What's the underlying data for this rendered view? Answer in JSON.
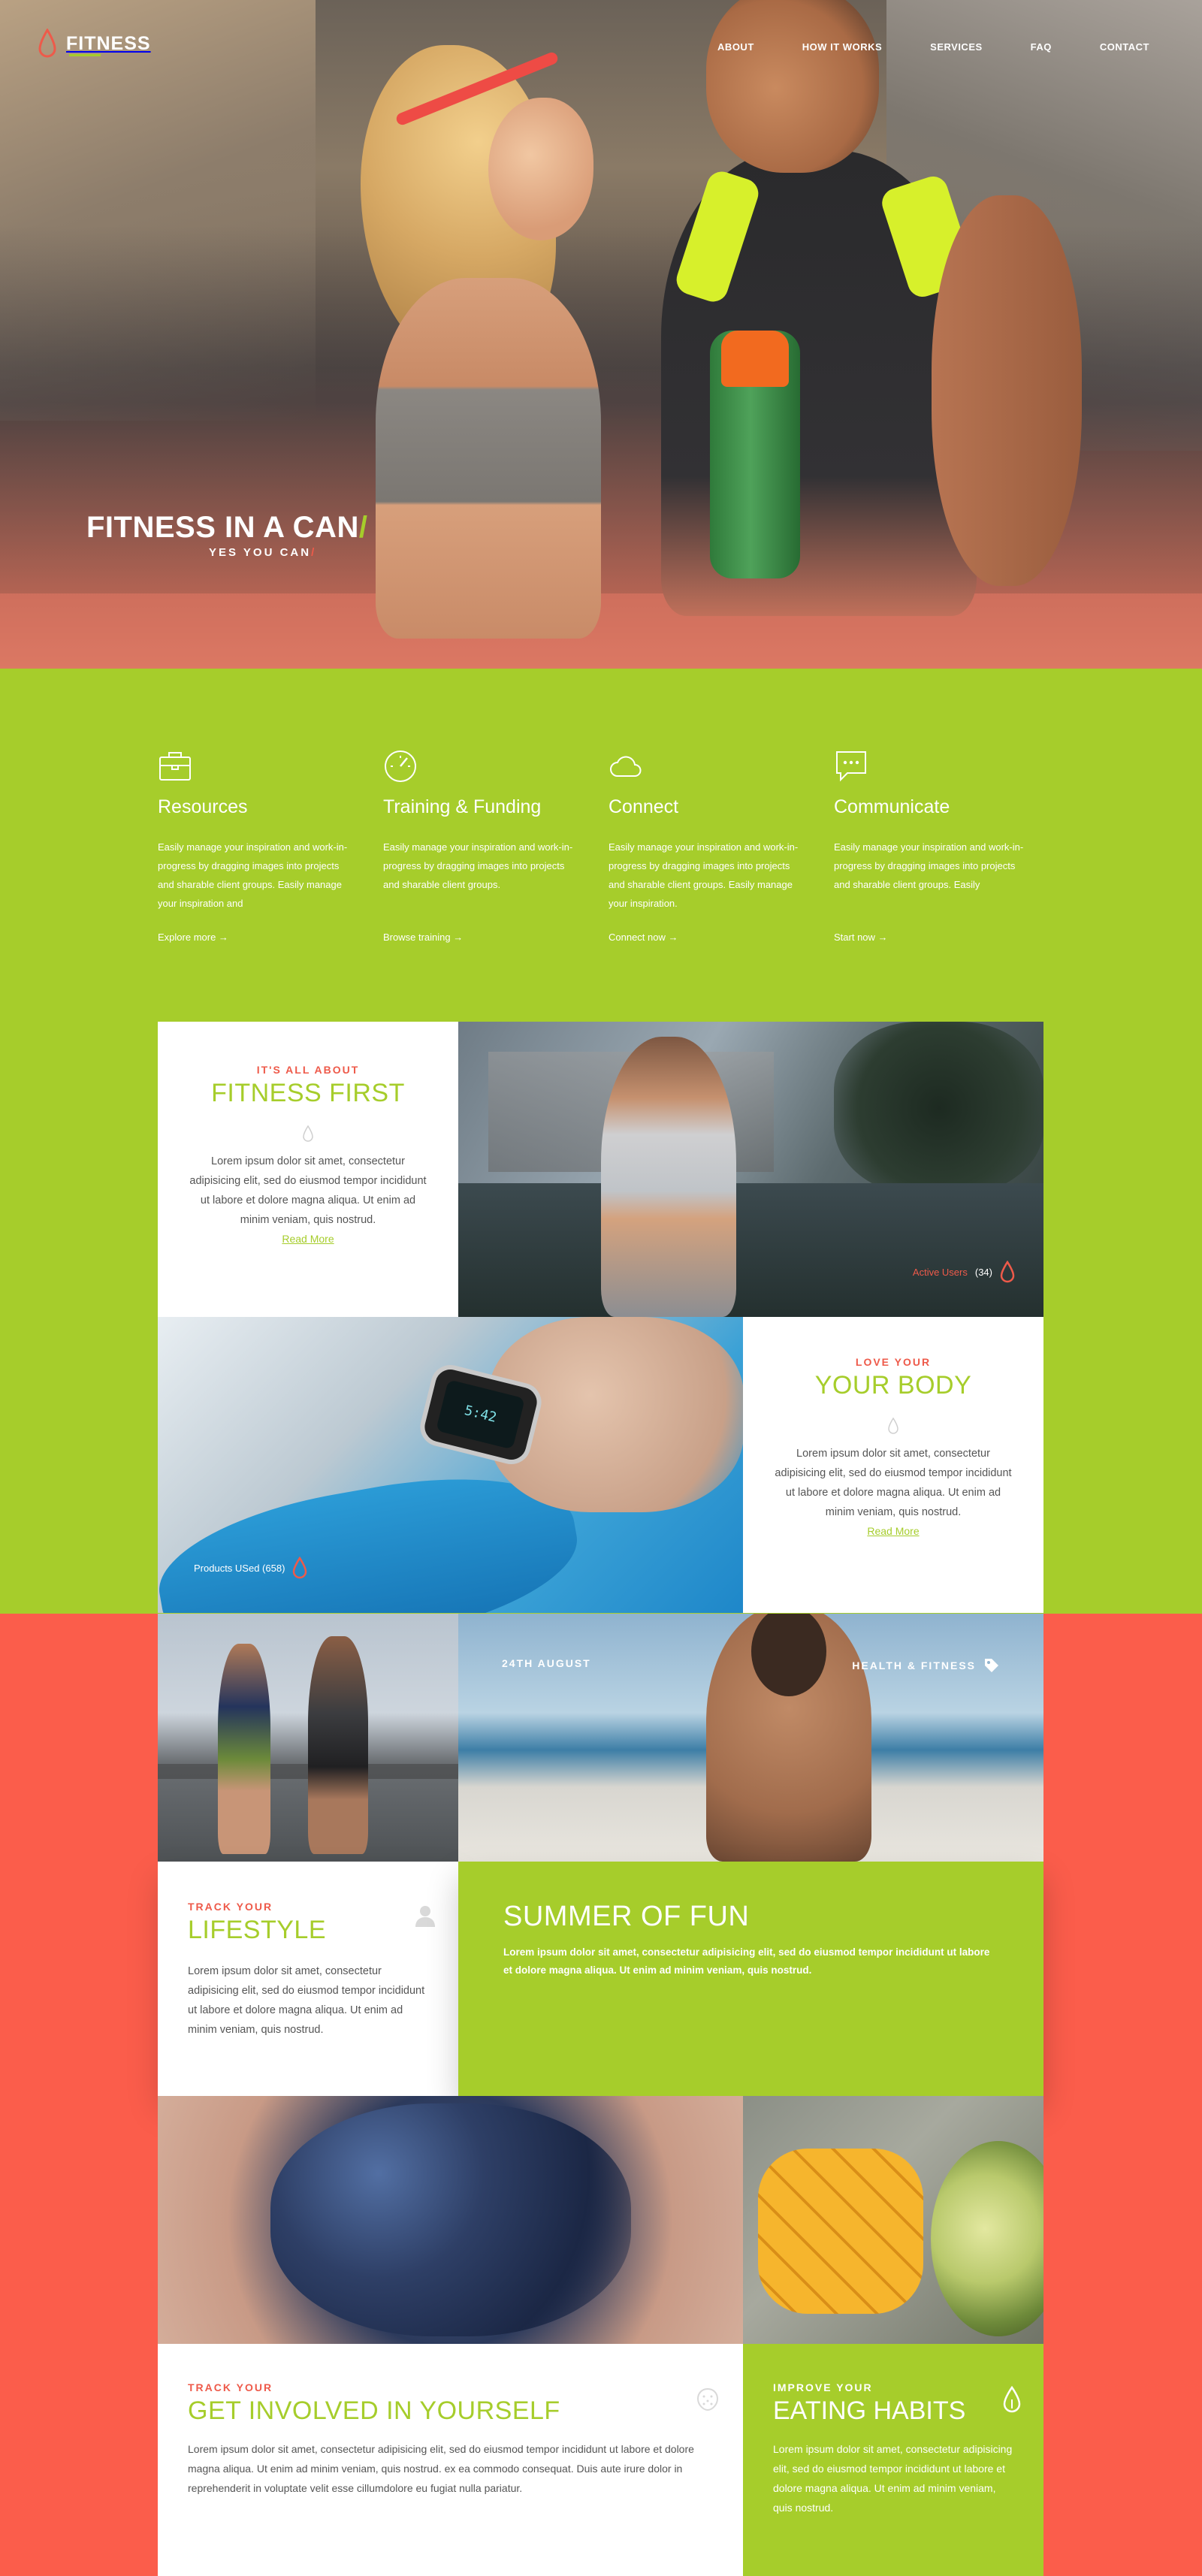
{
  "brand": {
    "name": "FITNESS",
    "accent": "#a6cd2b",
    "red": "#fb5d4b"
  },
  "nav": {
    "items": [
      "ABOUT",
      "HOW IT WORKS",
      "SERVICES",
      "FAQ",
      "CONTACT"
    ]
  },
  "hero": {
    "title": "FITNESS IN A CAN",
    "title_slash": "/",
    "subtitle": "YES YOU CAN",
    "subtitle_slash": "/"
  },
  "features": [
    {
      "icon": "briefcase-icon",
      "title": "Resources",
      "text": "Easily manage your inspiration and work-in-progress by dragging images into projects and sharable client groups. Easily manage your inspiration and",
      "link": "Explore more →"
    },
    {
      "icon": "speedometer-icon",
      "title": "Training & Funding",
      "text": "Easily manage your inspiration and work-in-progress by dragging images into projects and sharable client groups.",
      "link": "Browse training →"
    },
    {
      "icon": "cloud-icon",
      "title": "Connect",
      "text": "Easily manage your inspiration and work-in-progress by dragging images into projects and sharable client groups. Easily manage your inspiration.",
      "link": "Connect now →"
    },
    {
      "icon": "chat-bubble-icon",
      "title": "Communicate",
      "text": "Easily manage your inspiration and work-in-progress by dragging images into projects and sharable client groups. Easily",
      "link": "Start now →"
    }
  ],
  "fitness_first": {
    "kicker": "IT'S ALL ABOUT",
    "title": "FITNESS FIRST",
    "text": "Lorem ipsum dolor sit amet, consectetur adipisicing elit, sed do eiusmod tempor incididunt ut labore et dolore magna aliqua. Ut enim ad minim veniam, quis nostrud.",
    "link": "Read More",
    "tag_label": "Active Users",
    "tag_count": "(34)"
  },
  "love_body": {
    "kicker": "LOVE YOUR",
    "title": "YOUR BODY",
    "text": "Lorem ipsum dolor sit amet, consectetur adipisicing elit, sed do eiusmod tempor incididunt ut labore et dolore magna aliqua. Ut enim ad minim veniam, quis nostrud.",
    "link": "Read More",
    "tag_label": "Products USed (658)",
    "watch_time": "5:42"
  },
  "blog": {
    "date": "24TH AUGUST",
    "category": "HEALTH & FITNESS"
  },
  "lifestyle": {
    "kicker": "TRACK YOUR",
    "title": "LIFESTYLE",
    "text": "Lorem ipsum dolor sit amet, consectetur adipisicing elit, sed do eiusmod tempor incididunt ut labore et dolore magna aliqua. Ut enim ad minim veniam, quis nostrud."
  },
  "summer": {
    "title": "SUMMER OF FUN",
    "text": "Lorem ipsum dolor sit amet, consectetur adipisicing elit, sed do eiusmod tempor incididunt ut labore et dolore magna aliqua. Ut enim ad minim veniam, quis nostrud."
  },
  "involved": {
    "kicker": "TRACK YOUR",
    "title": "GET INVOLVED IN YOURSELF",
    "text": "Lorem ipsum dolor sit amet, consectetur adipisicing elit, sed do eiusmod tempor incididunt ut labore et dolore magna aliqua. Ut enim ad minim veniam, quis nostrud. ex ea commodo consequat. Duis aute irure dolor in reprehenderit in voluptate velit esse cillumdolore eu fugiat nulla pariatur."
  },
  "habits": {
    "kicker": "IMPROVE YOUR",
    "title": "EATING HABITS",
    "text": "Lorem ipsum dolor sit amet, consectetur adipisicing elit, sed do eiusmod tempor incididunt ut labore et dolore magna aliqua. Ut enim ad minim veniam, quis nostrud."
  }
}
